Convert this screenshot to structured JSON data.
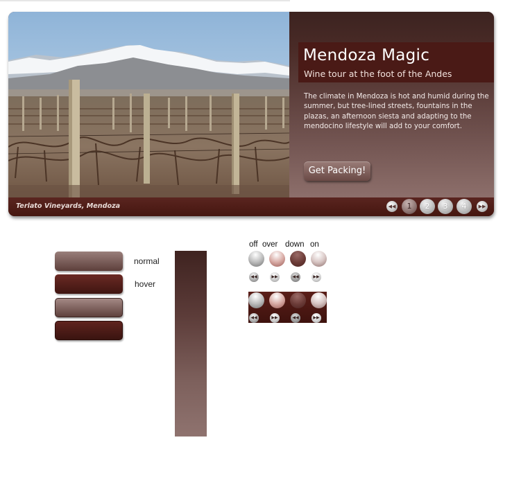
{
  "slider": {
    "title": "Mendoza Magic",
    "subtitle": "Wine tour at the foot of the Andes",
    "body": "The climate in Mendoza is hot and humid during the summer, but tree-lined streets, fountains in the plazas, an afternoon siesta and adapting to the mendocino lifestyle will add to your comfort.",
    "cta_label": "Get Packing!",
    "caption": "Terlato Vineyards, Mendoza",
    "prev_icon": "rewind-icon",
    "next_icon": "fast-forward-icon",
    "pages": [
      "1",
      "2",
      "3",
      "4"
    ],
    "active_page": "1"
  },
  "sprites": {
    "button_states": [
      "normal",
      "hover"
    ],
    "nav_states": [
      "off",
      "over",
      "down",
      "on"
    ]
  },
  "colors": {
    "maroon": "#4a1a16",
    "panel_top": "#3c2320",
    "panel_bottom": "#8d6f6b"
  }
}
